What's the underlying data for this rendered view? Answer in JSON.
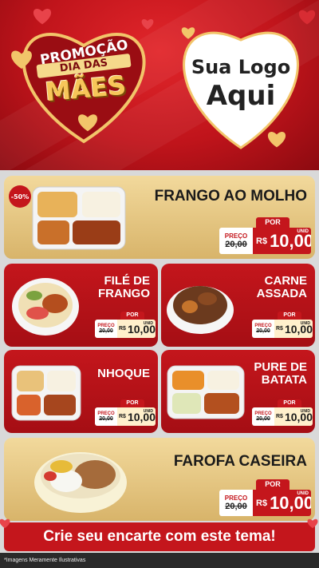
{
  "header": {
    "promo_line1": "PROMOÇÃO",
    "promo_line2": "DIA DAS",
    "promo_line3": "MÃES",
    "logo_line1": "Sua Logo",
    "logo_line2": "Aqui"
  },
  "colors": {
    "brand_red": "#c4161c",
    "gold": "#e4c27e",
    "dark_red": "#8c0a10"
  },
  "items": [
    {
      "name": "FRANGO AO MOLHO",
      "discount": "-50%",
      "por": "POR",
      "preco_label": "PREÇO",
      "currency": "R$",
      "old_price": "20,00",
      "new_price": "10,00",
      "unit": "UNID"
    },
    {
      "name_line1": "FILÉ DE",
      "name_line2": "FRANGO",
      "por": "POR",
      "preco_label": "PREÇO",
      "currency": "R$",
      "old_price": "20,00",
      "new_price": "10,00",
      "unit": "UNID"
    },
    {
      "name_line1": "CARNE",
      "name_line2": "ASSADA",
      "por": "POR",
      "preco_label": "PREÇO",
      "currency": "R$",
      "old_price": "20,00",
      "new_price": "10,00",
      "unit": "UNID"
    },
    {
      "name": "NHOQUE",
      "por": "POR",
      "preco_label": "PREÇO",
      "currency": "R$",
      "old_price": "20,00",
      "new_price": "10,00",
      "unit": "UNID"
    },
    {
      "name_line1": "PURE DE",
      "name_line2": "BATATA",
      "por": "POR",
      "preco_label": "PREÇO",
      "currency": "R$",
      "old_price": "20,00",
      "new_price": "10,00",
      "unit": "UNID"
    },
    {
      "name": "FAROFA CASEIRA",
      "por": "POR",
      "preco_label": "PREÇO",
      "currency": "R$",
      "old_price": "20,00",
      "new_price": "10,00",
      "unit": "UNID"
    }
  ],
  "cta": "Crie seu encarte com este tema!",
  "footer": "*Imagens Meramente Ilustrativas"
}
